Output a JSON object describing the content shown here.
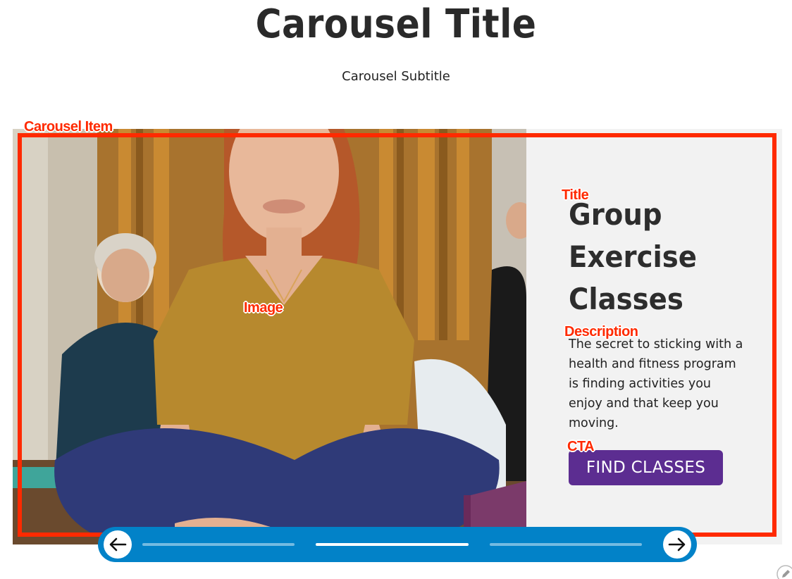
{
  "header": {
    "title": "Carousel Title",
    "subtitle": "Carousel Subtitle"
  },
  "carousel_item": {
    "image": {
      "description_icon": "photo-group-exercise"
    },
    "title": "Group Exercise Classes",
    "description": "The secret to sticking with a health and fitness program is finding activities you enjoy and that keep you moving.",
    "cta_label": "FIND CLASSES"
  },
  "annotations": {
    "carousel_item": "Carousel Item",
    "title": "Title",
    "image": "Image",
    "description": "Description",
    "cta": "CTA"
  },
  "navigation": {
    "prev_icon": "arrow-left-icon",
    "next_icon": "arrow-right-icon",
    "segments": 3,
    "active_segment": 2
  },
  "colors": {
    "annotation": "#ff2a00",
    "nav_bar": "#0282c8",
    "cta_background": "#5c2d91",
    "content_panel": "#f2f2f2"
  }
}
